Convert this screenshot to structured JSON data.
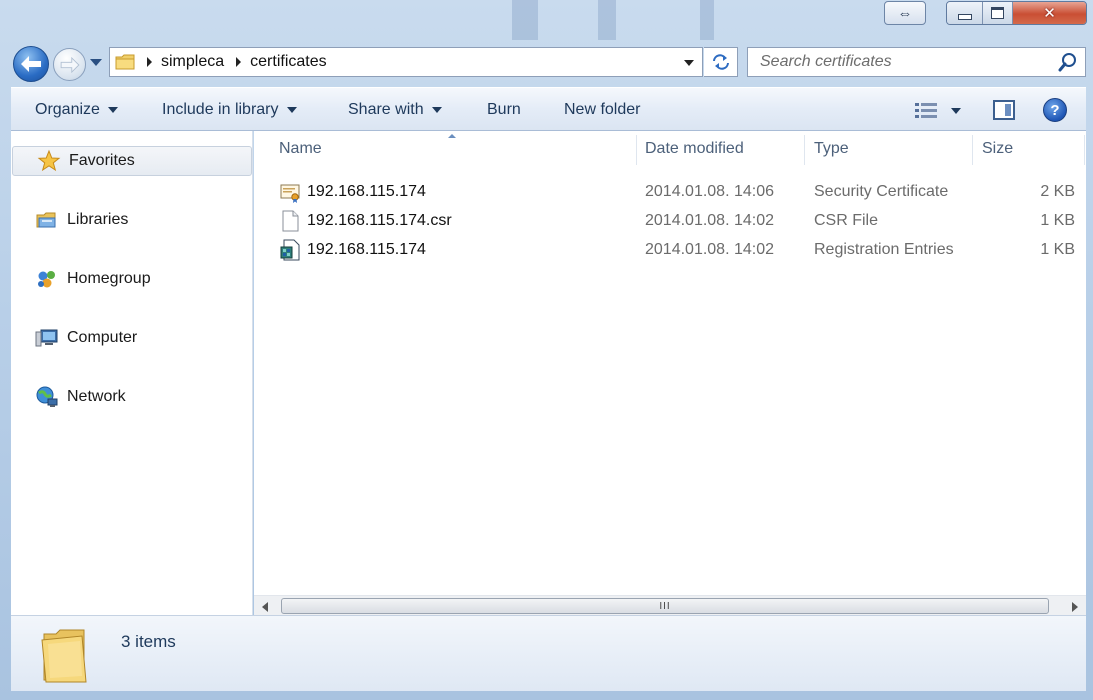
{
  "window": {
    "caption_buttons": {
      "snap": "⇔"
    }
  },
  "navigation": {
    "back": "back",
    "forward": "forward"
  },
  "address_bar": {
    "breadcrumbs": [
      "simpleca",
      "certificates"
    ]
  },
  "search": {
    "placeholder": "Search certificates"
  },
  "toolbar": {
    "organize": "Organize",
    "include_in_library": "Include in library",
    "share_with": "Share with",
    "burn": "Burn",
    "new_folder": "New folder",
    "help": "?"
  },
  "nav_pane": {
    "favorites": "Favorites",
    "libraries": "Libraries",
    "homegroup": "Homegroup",
    "computer": "Computer",
    "network": "Network"
  },
  "file_list": {
    "columns": {
      "name": "Name",
      "date": "Date modified",
      "type": "Type",
      "size": "Size"
    },
    "files": [
      {
        "name": "192.168.115.174",
        "date": "2014.01.08. 14:06",
        "type": "Security Certificate",
        "size": "2 KB",
        "icon": "certificate-icon"
      },
      {
        "name": "192.168.115.174.csr",
        "date": "2014.01.08. 14:02",
        "type": "CSR File",
        "size": "1 KB",
        "icon": "blank-file-icon"
      },
      {
        "name": "192.168.115.174",
        "date": "2014.01.08. 14:02",
        "type": "Registration Entries",
        "size": "1 KB",
        "icon": "registry-file-icon"
      }
    ],
    "scroll_thumb_grip": "III"
  },
  "details_pane": {
    "item_count": "3 items"
  },
  "colors": {
    "accent": "#1e395b",
    "close_button": "#c94f34",
    "frame": "#b8cfe8"
  }
}
